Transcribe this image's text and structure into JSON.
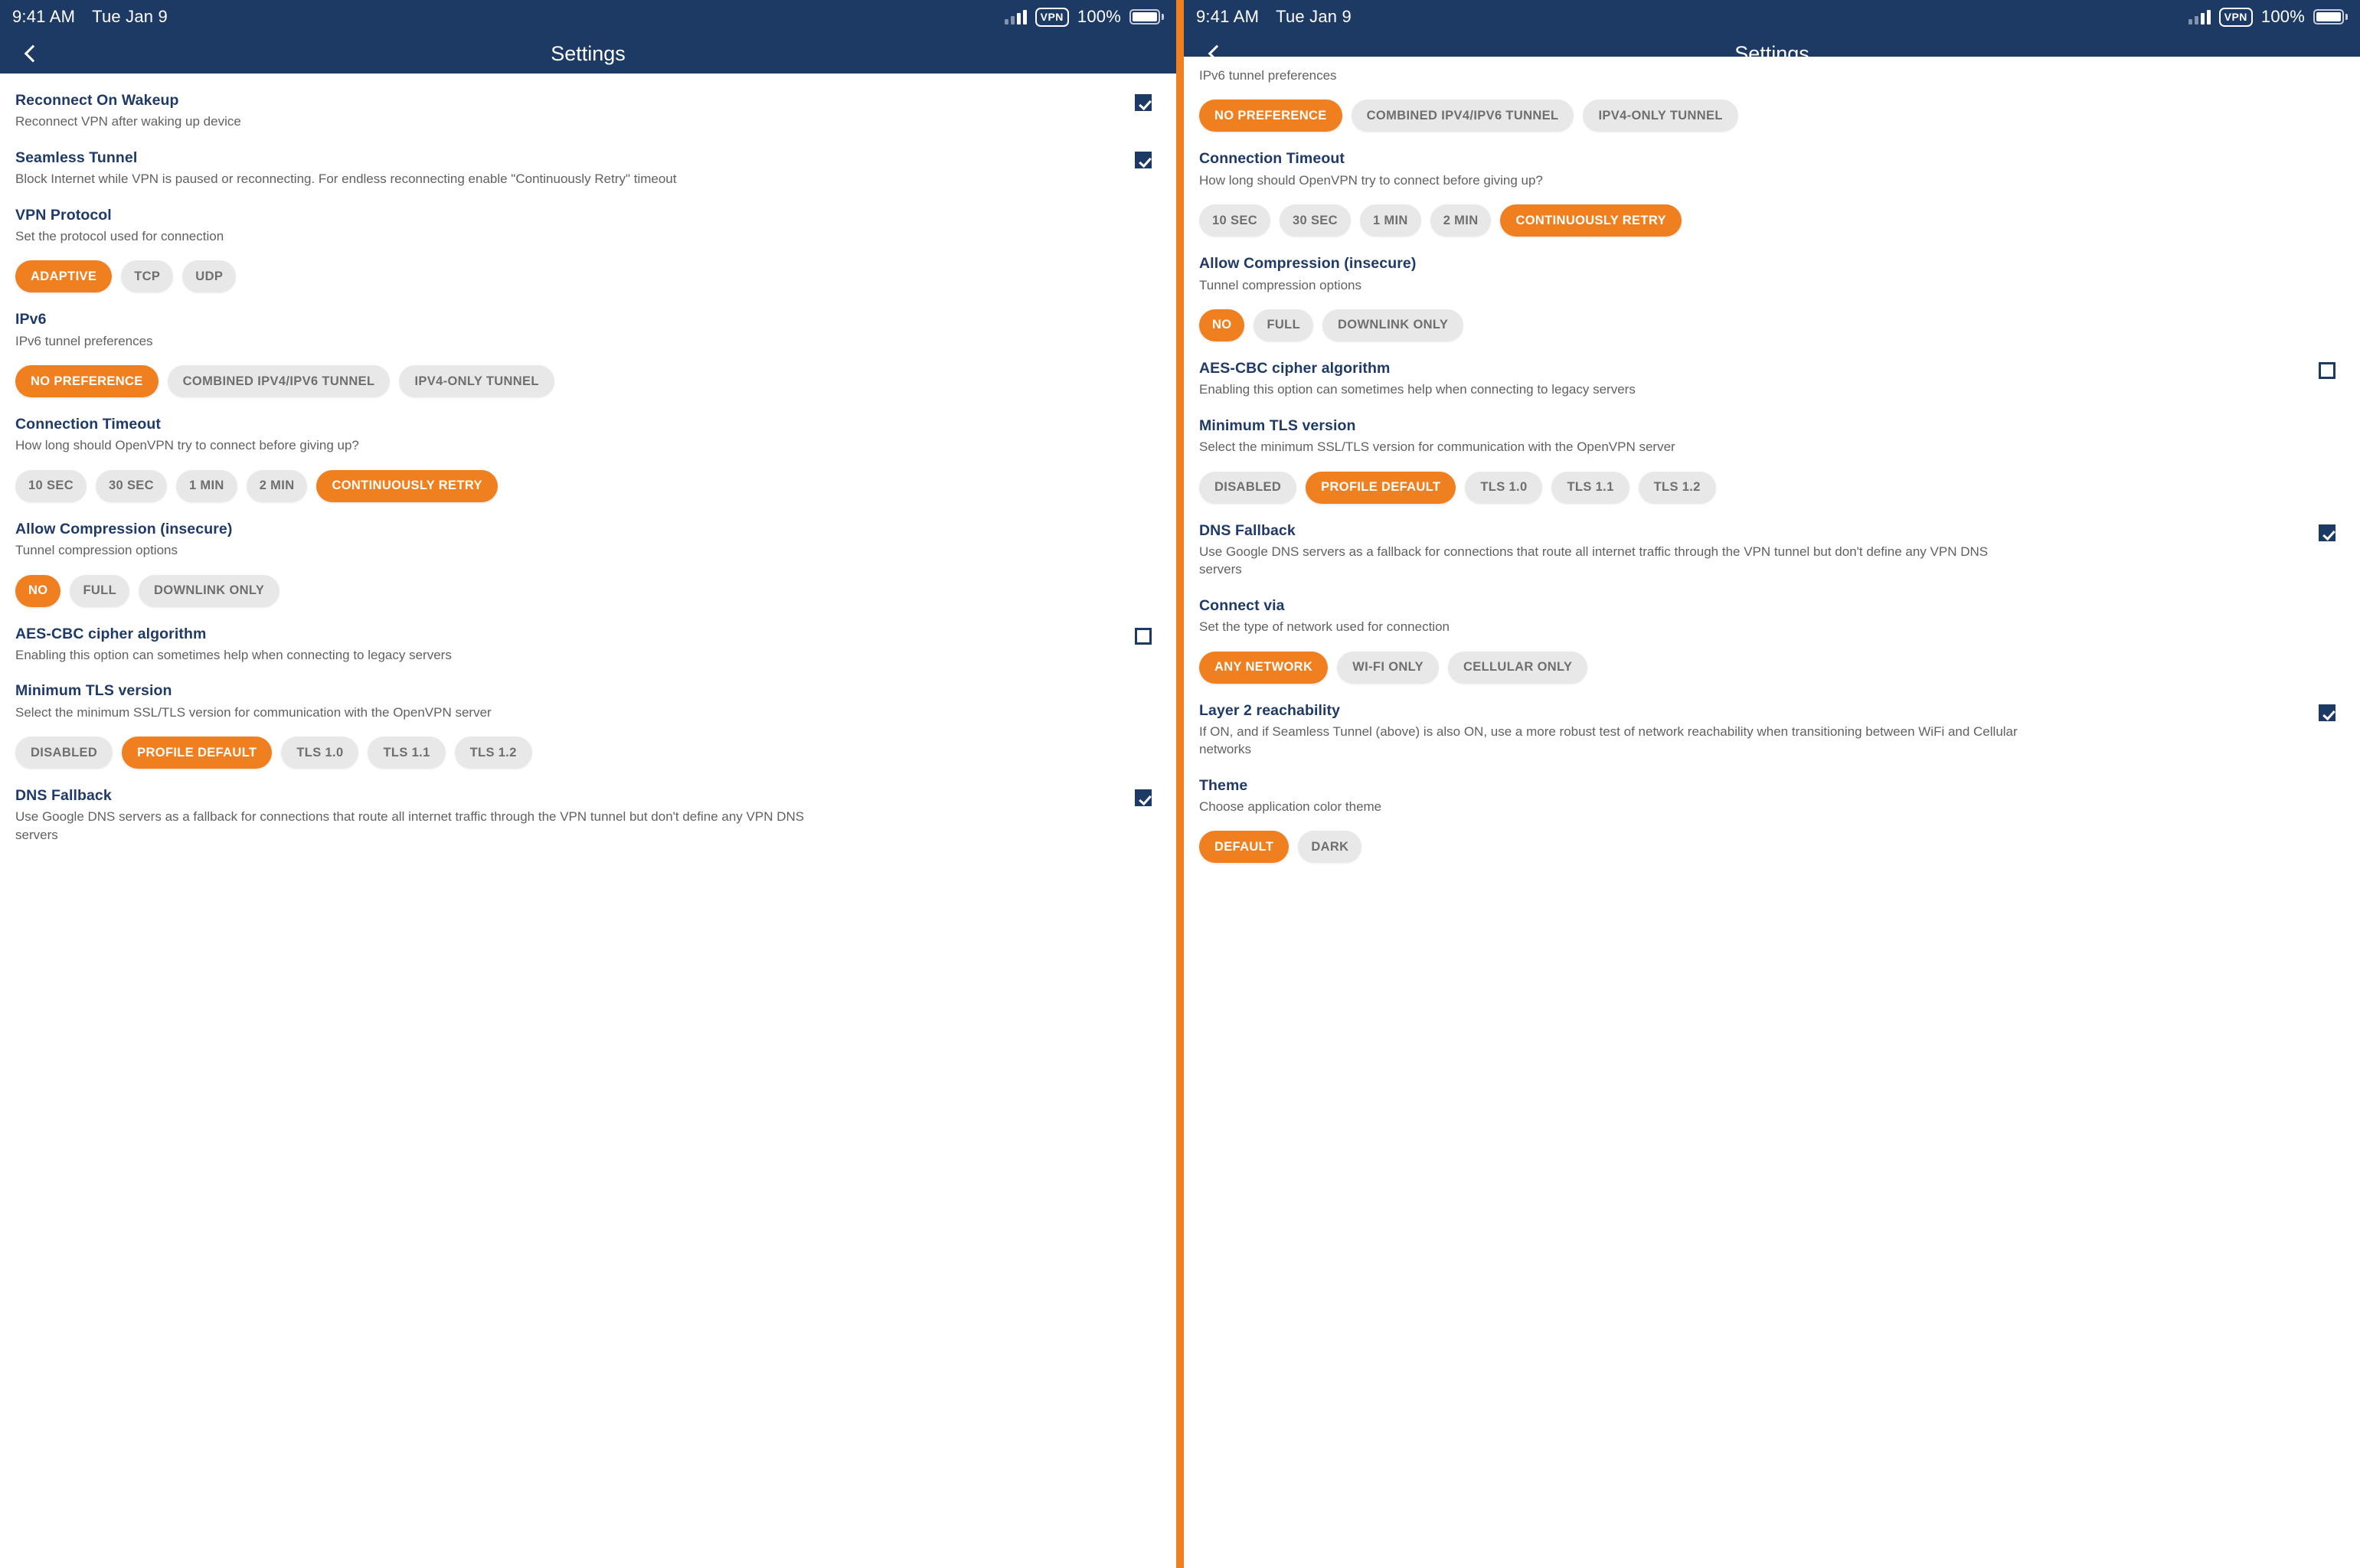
{
  "status_bar": {
    "time": "9:41 AM",
    "date": "Tue Jan 9",
    "vpn_badge": "VPN",
    "battery_percent": "100%",
    "signal_icon": "cellular-signal-icon",
    "battery_icon": "battery-full-icon"
  },
  "nav": {
    "title": "Settings",
    "back_icon": "chevron-left-icon"
  },
  "colors": {
    "navy": "#1d3a65",
    "orange": "#ef7f1f",
    "chip_bg": "#e8e8e8",
    "chip_text": "#6f6f6f",
    "title": "#1f3a68",
    "subtitle": "#616161",
    "divider": "#F07F20"
  },
  "left_panel": {
    "sections": [
      {
        "key": "reconnect_on_wakeup",
        "title": "Reconnect On Wakeup",
        "subtitle": "Reconnect VPN after waking up device",
        "control": "checkbox",
        "checked": true
      },
      {
        "key": "seamless_tunnel",
        "title": "Seamless Tunnel",
        "subtitle": "Block Internet while VPN is paused or reconnecting. For endless reconnecting enable \"Continuously Retry\" timeout",
        "control": "checkbox",
        "checked": true
      },
      {
        "key": "vpn_protocol",
        "title": "VPN Protocol",
        "subtitle": "Set the protocol used for connection",
        "control": "chips",
        "options": [
          "ADAPTIVE",
          "TCP",
          "UDP"
        ],
        "selected": "ADAPTIVE"
      },
      {
        "key": "ipv6",
        "title": "IPv6",
        "subtitle": "IPv6 tunnel preferences",
        "control": "chips",
        "options": [
          "NO PREFERENCE",
          "COMBINED IPV4/IPV6 TUNNEL",
          "IPV4-ONLY TUNNEL"
        ],
        "selected": "NO PREFERENCE"
      },
      {
        "key": "connection_timeout",
        "title": "Connection Timeout",
        "subtitle": "How long should OpenVPN try to connect before giving up?",
        "control": "chips",
        "options": [
          "10 SEC",
          "30 SEC",
          "1 MIN",
          "2 MIN",
          "CONTINUOUSLY RETRY"
        ],
        "selected": "CONTINUOUSLY RETRY"
      },
      {
        "key": "allow_compression",
        "title": "Allow Compression (insecure)",
        "subtitle": "Tunnel compression options",
        "control": "chips",
        "options": [
          "NO",
          "FULL",
          "DOWNLINK ONLY"
        ],
        "selected": "NO"
      },
      {
        "key": "aes_cbc_cipher",
        "title": "AES-CBC cipher algorithm",
        "subtitle": "Enabling this option can sometimes help when connecting to legacy servers",
        "control": "checkbox",
        "checked": false
      },
      {
        "key": "minimum_tls_version",
        "title": "Minimum TLS version",
        "subtitle": "Select the minimum SSL/TLS version for communication with the OpenVPN server",
        "control": "chips",
        "options": [
          "DISABLED",
          "PROFILE DEFAULT",
          "TLS 1.0",
          "TLS 1.1",
          "TLS 1.2"
        ],
        "selected": "PROFILE DEFAULT"
      },
      {
        "key": "dns_fallback",
        "title": "DNS Fallback",
        "subtitle": "Use Google DNS servers as a fallback for connections that route all internet traffic through the VPN tunnel but don't define any VPN DNS servers",
        "control": "checkbox",
        "checked": true
      }
    ]
  },
  "right_panel": {
    "partial_top": {
      "subtitle": "IPv6 tunnel preferences",
      "options": [
        "NO PREFERENCE",
        "COMBINED IPV4/IPV6 TUNNEL",
        "IPV4-ONLY TUNNEL"
      ],
      "selected": "NO PREFERENCE"
    },
    "sections": [
      {
        "key": "connection_timeout",
        "title": "Connection Timeout",
        "subtitle": "How long should OpenVPN try to connect before giving up?",
        "control": "chips",
        "options": [
          "10 SEC",
          "30 SEC",
          "1 MIN",
          "2 MIN",
          "CONTINUOUSLY RETRY"
        ],
        "selected": "CONTINUOUSLY RETRY"
      },
      {
        "key": "allow_compression",
        "title": "Allow Compression (insecure)",
        "subtitle": "Tunnel compression options",
        "control": "chips",
        "options": [
          "NO",
          "FULL",
          "DOWNLINK ONLY"
        ],
        "selected": "NO"
      },
      {
        "key": "aes_cbc_cipher",
        "title": "AES-CBC cipher algorithm",
        "subtitle": "Enabling this option can sometimes help when connecting to legacy servers",
        "control": "checkbox",
        "checked": false
      },
      {
        "key": "minimum_tls_version",
        "title": "Minimum TLS version",
        "subtitle": "Select the minimum SSL/TLS version for communication with the OpenVPN server",
        "control": "chips",
        "options": [
          "DISABLED",
          "PROFILE DEFAULT",
          "TLS 1.0",
          "TLS 1.1",
          "TLS 1.2"
        ],
        "selected": "PROFILE DEFAULT"
      },
      {
        "key": "dns_fallback",
        "title": "DNS Fallback",
        "subtitle": "Use Google DNS servers as a fallback for connections that route all internet traffic through the VPN tunnel but don't define any VPN DNS servers",
        "control": "checkbox",
        "checked": true
      },
      {
        "key": "connect_via",
        "title": "Connect via",
        "subtitle": "Set the type of network used for connection",
        "control": "chips",
        "options": [
          "ANY NETWORK",
          "WI-FI ONLY",
          "CELLULAR ONLY"
        ],
        "selected": "ANY NETWORK"
      },
      {
        "key": "layer2_reachability",
        "title": "Layer 2 reachability",
        "subtitle": "If ON, and if Seamless Tunnel (above) is also ON, use a more robust test of network reachability when transitioning between WiFi and Cellular networks",
        "control": "checkbox",
        "checked": true
      },
      {
        "key": "theme",
        "title": "Theme",
        "subtitle": "Choose application color theme",
        "control": "chips",
        "options": [
          "DEFAULT",
          "DARK"
        ],
        "selected": "DEFAULT"
      }
    ]
  }
}
